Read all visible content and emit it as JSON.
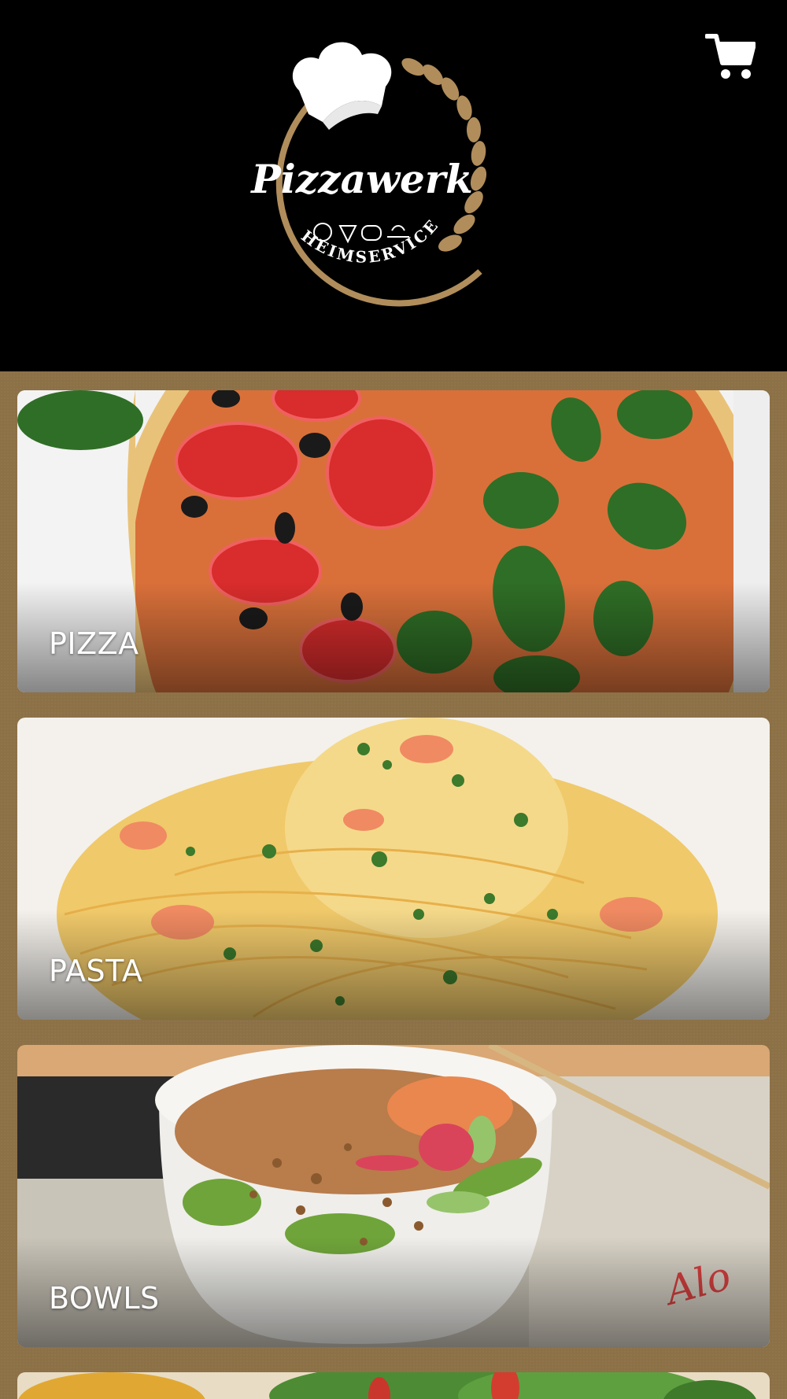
{
  "header": {
    "brand_name": "Pizzawerk",
    "brand_tagline": "HEIMSERVICE",
    "cart_icon": "shopping-cart-icon",
    "logo_icon": "chef-hat-icon"
  },
  "colors": {
    "header_bg": "#000000",
    "content_bg": "#8c7046",
    "logo_gold": "#b08d5b",
    "label_text": "#ffffff"
  },
  "categories": [
    {
      "label": "PIZZA"
    },
    {
      "label": "PASTA"
    },
    {
      "label": "BOWLS"
    },
    {
      "label": ""
    }
  ]
}
